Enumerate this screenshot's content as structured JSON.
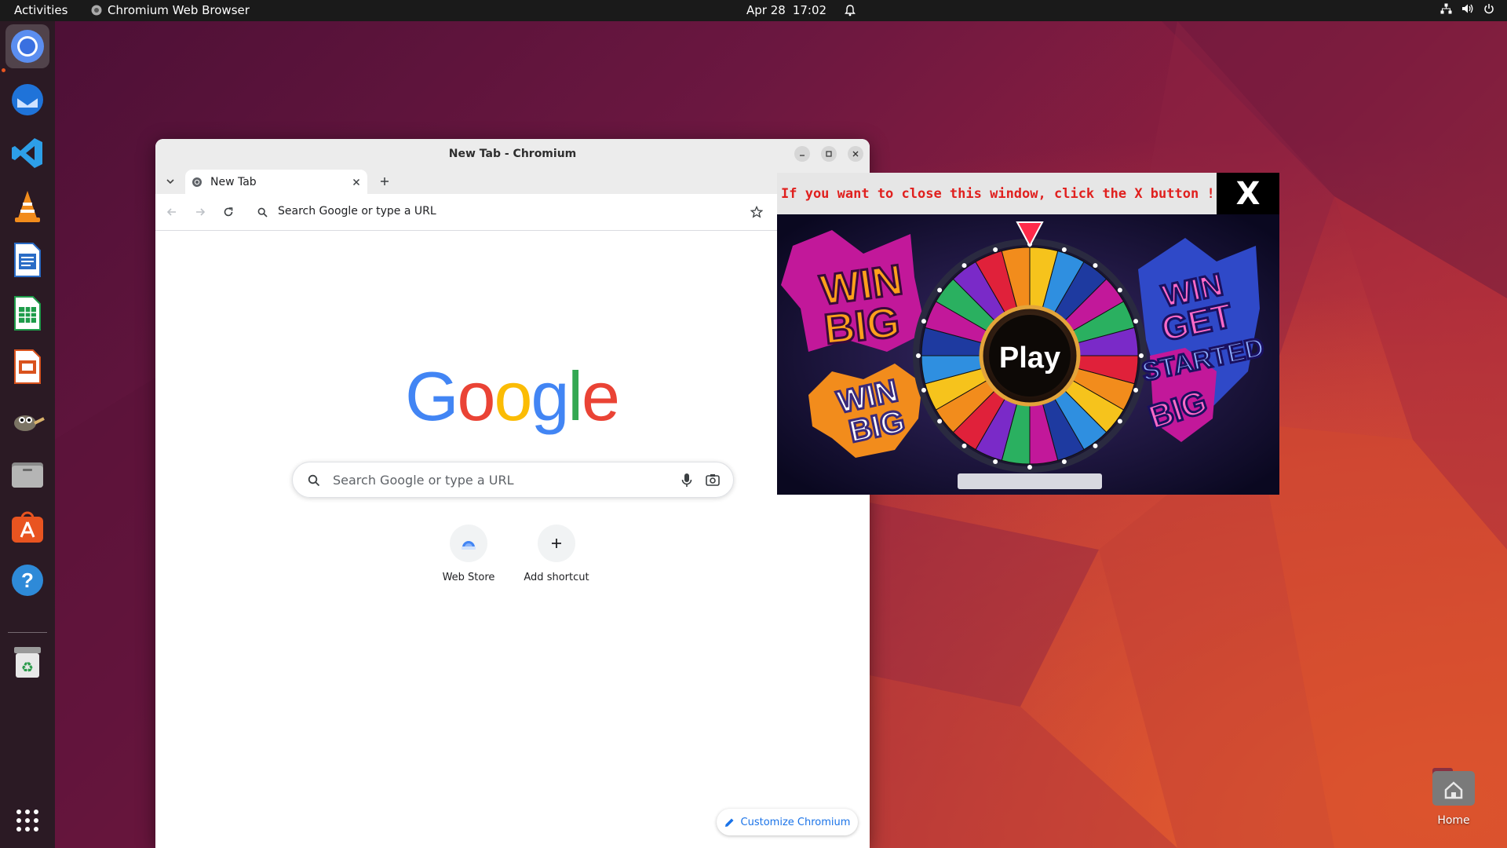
{
  "topbar": {
    "activities": "Activities",
    "app_name": "Chromium Web Browser",
    "date": "Apr 28",
    "time": "17:02"
  },
  "dock": {
    "items": [
      "chromium",
      "thunderbird",
      "vscode",
      "vlc",
      "libreoffice-writer",
      "libreoffice-calc",
      "libreoffice-impress",
      "gimp",
      "files",
      "app-center",
      "help",
      "trash",
      "show-apps"
    ]
  },
  "browser": {
    "window_title": "New Tab - Chromium",
    "tab_title": "New Tab",
    "omnibox_placeholder": "Search Google or type a URL",
    "search_placeholder": "Search Google or type a URL",
    "logo_letters": [
      "G",
      "o",
      "o",
      "g",
      "l",
      "e"
    ],
    "shortcuts": [
      {
        "label": "Web Store"
      },
      {
        "label": "Add shortcut"
      }
    ],
    "customize_label": "Customize Chromium"
  },
  "popup": {
    "message": "If you want to close this window, click the X button !",
    "close_label": "X",
    "ad_texts": {
      "win_big_1_a": "WIN",
      "win_big_1_b": "BIG",
      "win_big_2_a": "WIN",
      "win_big_2_b": "BIG",
      "play": "Play",
      "right_1": "WIN",
      "right_2": "GET",
      "right_3": "STARTED",
      "right_4": "BIG"
    }
  },
  "desktop": {
    "home_label": "Home"
  },
  "colors": {
    "accent_orange": "#e95420",
    "google_blue": "#4285f4",
    "google_red": "#ea4335",
    "google_yellow": "#fbbc05",
    "google_green": "#34a853",
    "popup_message": "#e0201e"
  }
}
